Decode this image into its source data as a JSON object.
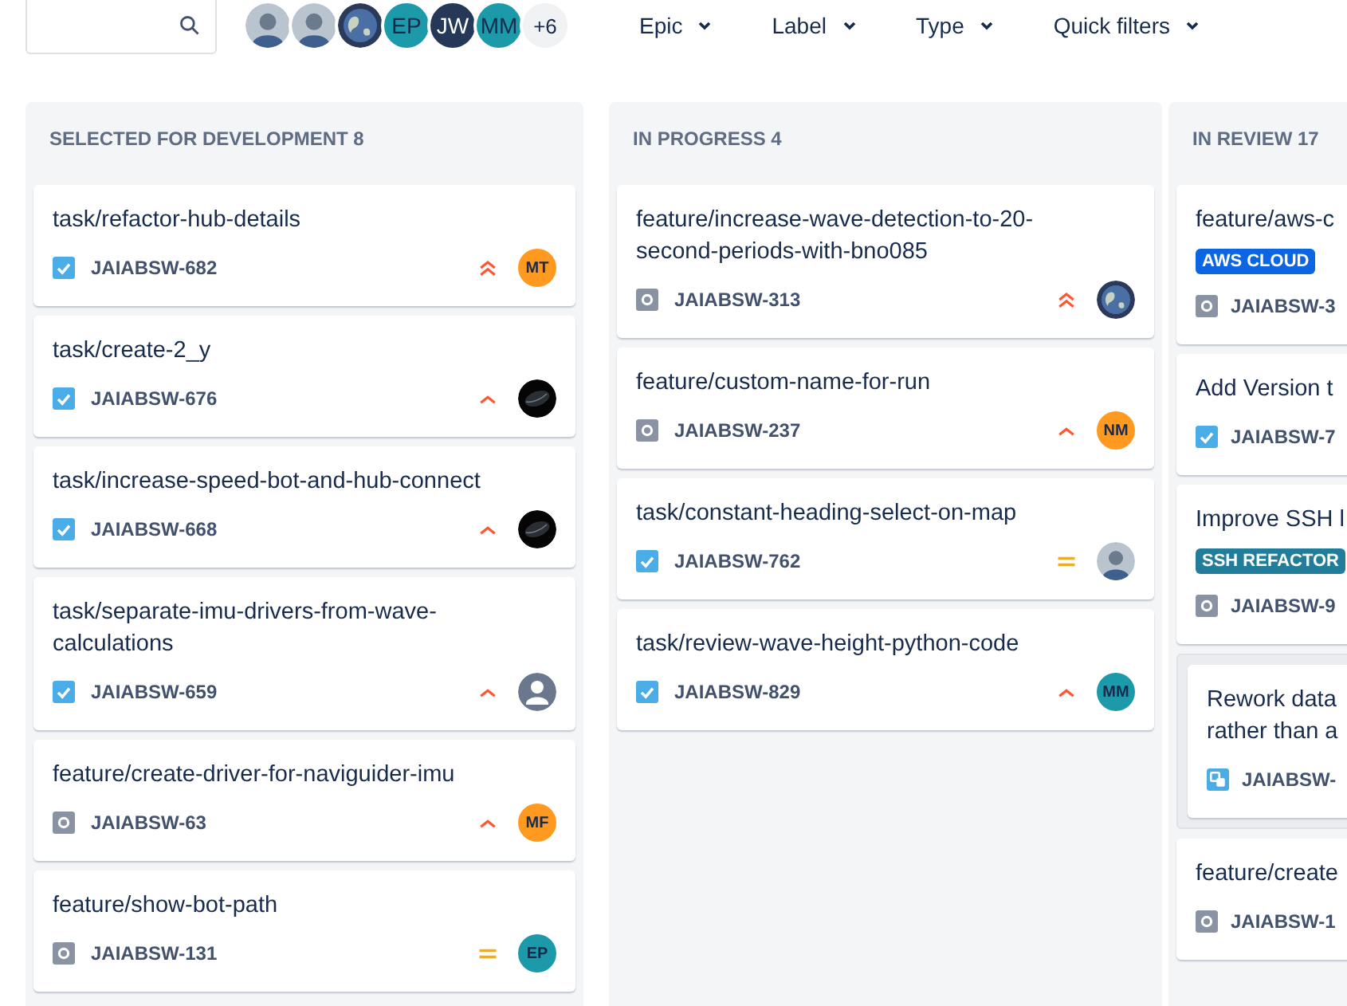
{
  "toolbar": {
    "avatars": [
      {
        "kind": "person"
      },
      {
        "kind": "person"
      },
      {
        "kind": "globe"
      },
      {
        "kind": "initials",
        "text": "EP",
        "color": "#1d9aaa"
      },
      {
        "kind": "initials",
        "text": "JW",
        "color": "#253858"
      },
      {
        "kind": "initials",
        "text": "MM",
        "color": "#1d9aaa"
      }
    ],
    "more_avatars": "+6",
    "filters": [
      "Epic",
      "Label",
      "Type",
      "Quick filters"
    ]
  },
  "columns": [
    {
      "title": "SELECTED FOR DEVELOPMENT 8",
      "cards": [
        {
          "kind": "card",
          "title": "task/refactor-hub-details",
          "issue_type": {
            "kind": "task"
          },
          "key": "JAIABSW-682",
          "priority": {
            "kind": "highest"
          },
          "avatar": {
            "kind": "initials",
            "text": "MT",
            "color": "#ff991f"
          }
        },
        {
          "kind": "card",
          "title": "task/create-2_y",
          "issue_type": {
            "kind": "task"
          },
          "key": "JAIABSW-676",
          "priority": {
            "kind": "high"
          },
          "avatar": {
            "kind": "dark"
          }
        },
        {
          "kind": "card",
          "title": "task/increase-speed-bot-and-hub-connect",
          "issue_type": {
            "kind": "task"
          },
          "key": "JAIABSW-668",
          "priority": {
            "kind": "high"
          },
          "avatar": {
            "kind": "dark"
          }
        },
        {
          "kind": "card",
          "title": "task/separate-imu-drivers-from-wave-calculations",
          "issue_type": {
            "kind": "task"
          },
          "key": "JAIABSW-659",
          "priority": {
            "kind": "high"
          },
          "avatar": {
            "kind": "default"
          }
        },
        {
          "kind": "card",
          "title": "feature/create-driver-for-naviguider-imu",
          "issue_type": {
            "kind": "story"
          },
          "key": "JAIABSW-63",
          "priority": {
            "kind": "high"
          },
          "avatar": {
            "kind": "initials",
            "text": "MF",
            "color": "#ff991f"
          }
        },
        {
          "kind": "card",
          "title": "feature/show-bot-path",
          "issue_type": {
            "kind": "story"
          },
          "key": "JAIABSW-131",
          "priority": {
            "kind": "medium"
          },
          "avatar": {
            "kind": "initials",
            "text": "EP",
            "color": "#1d9aaa"
          }
        }
      ]
    },
    {
      "title": "IN PROGRESS 4",
      "cards": [
        {
          "kind": "card",
          "title": "feature/increase-wave-detection-to-20-second-periods-with-bno085",
          "issue_type": {
            "kind": "story"
          },
          "key": "JAIABSW-313",
          "priority": {
            "kind": "highest"
          },
          "avatar": {
            "kind": "globe"
          }
        },
        {
          "kind": "card",
          "title": "feature/custom-name-for-run",
          "issue_type": {
            "kind": "story"
          },
          "key": "JAIABSW-237",
          "priority": {
            "kind": "high"
          },
          "avatar": {
            "kind": "initials",
            "text": "NM",
            "color": "#ff991f"
          }
        },
        {
          "kind": "card",
          "title": "task/constant-heading-select-on-map",
          "issue_type": {
            "kind": "task"
          },
          "key": "JAIABSW-762",
          "priority": {
            "kind": "medium"
          },
          "avatar": {
            "kind": "person"
          }
        },
        {
          "kind": "card",
          "title": "task/review-wave-height-python-code",
          "issue_type": {
            "kind": "task"
          },
          "key": "JAIABSW-829",
          "priority": {
            "kind": "high"
          },
          "avatar": {
            "kind": "initials",
            "text": "MM",
            "color": "#1d9aaa"
          }
        }
      ]
    },
    {
      "title": "IN REVIEW 17",
      "cards": [
        {
          "kind": "card",
          "title": "feature/aws-c",
          "label": {
            "text": "AWS CLOUD",
            "color": "#0c66e4"
          },
          "issue_type": {
            "kind": "story"
          },
          "key": "JAIABSW-3"
        },
        {
          "kind": "card",
          "title": "Add Version t",
          "issue_type": {
            "kind": "task"
          },
          "key": "JAIABSW-7"
        },
        {
          "kind": "card",
          "title": "Improve SSH l",
          "label": {
            "text": "SSH REFACTOR",
            "color": "#227d9b"
          },
          "issue_type": {
            "kind": "story"
          },
          "key": "JAIABSW-9"
        },
        {
          "kind": "group",
          "cards": [
            {
              "kind": "card",
              "title": "Rework data rather than a",
              "issue_type": {
                "kind": "subtask"
              },
              "key": "JAIABSW-"
            }
          ]
        },
        {
          "kind": "card",
          "title": "feature/create",
          "issue_type": {
            "kind": "story"
          },
          "key": "JAIABSW-1"
        }
      ]
    }
  ]
}
